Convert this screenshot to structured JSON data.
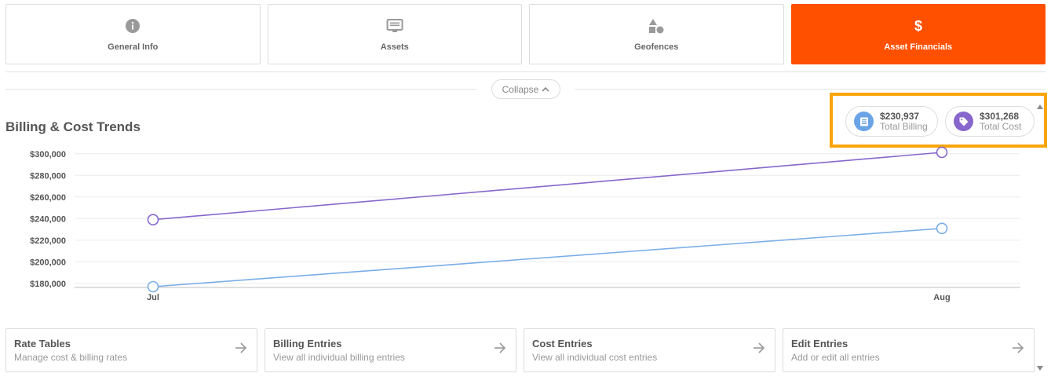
{
  "tabs": [
    {
      "label": "General Info",
      "icon": "info-circle-icon",
      "active": false
    },
    {
      "label": "Assets",
      "icon": "monitor-icon",
      "active": false
    },
    {
      "label": "Geofences",
      "icon": "shapes-icon",
      "active": false
    },
    {
      "label": "Asset Financials",
      "icon": "dollar-icon",
      "active": true
    }
  ],
  "collapse": {
    "label": "Collapse"
  },
  "section": {
    "title": "Billing & Cost Trends"
  },
  "summary": {
    "billing": {
      "value": "$230,937",
      "caption": "Total Billing",
      "color": "#6aa3e6"
    },
    "cost": {
      "value": "$301,268",
      "caption": "Total Cost",
      "color": "#8767cc"
    }
  },
  "colors": {
    "accent": "#ff5000",
    "highlight": "#f9a50a",
    "billing": "#7aaee8",
    "cost": "#8767cc"
  },
  "chart_data": {
    "type": "line",
    "categories": [
      "Jul",
      "Aug"
    ],
    "series": [
      {
        "key": "cost",
        "values": [
          239000,
          301268
        ]
      },
      {
        "key": "billing",
        "values": [
          177000,
          230937
        ]
      }
    ],
    "yticks": [
      "$180,000",
      "$200,000",
      "$220,000",
      "$240,000",
      "$260,000",
      "$280,000",
      "$300,000"
    ],
    "ytick_values": [
      180000,
      200000,
      220000,
      240000,
      260000,
      280000,
      300000
    ],
    "ylim": [
      177000,
      302000
    ],
    "grid": true
  },
  "cards": [
    {
      "title": "Rate Tables",
      "subtitle": "Manage cost & billing rates"
    },
    {
      "title": "Billing Entries",
      "subtitle": "View all individual billing entries"
    },
    {
      "title": "Cost Entries",
      "subtitle": "View all individual cost entries"
    },
    {
      "title": "Edit Entries",
      "subtitle": "Add or edit all entries"
    }
  ]
}
